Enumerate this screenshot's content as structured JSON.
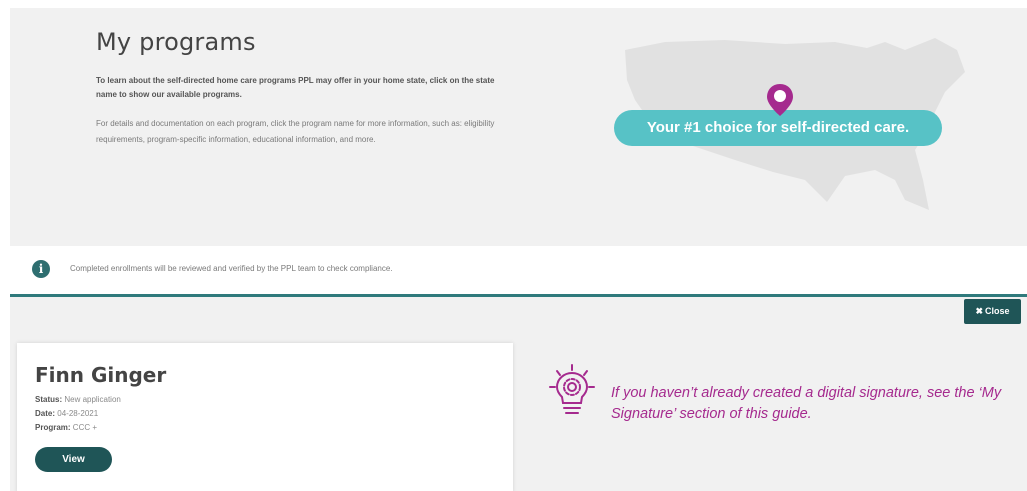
{
  "header": {
    "title": "My programs",
    "intro": "To learn about the self-directed home care programs PPL may offer in your home state, click on the state name to show our available programs.",
    "details": "For details and documentation on each program, click the program name for more information, such as: eligibility requirements, program-specific information, educational information, and more.",
    "tagline": "Your #1 choice for self-directed care."
  },
  "notice": {
    "icon": "info-icon",
    "text": "Completed enrollments will be reviewed and verified by the PPL team to check compliance."
  },
  "close_button": {
    "icon": "close-icon",
    "label": "Close"
  },
  "enrollment_card": {
    "name": "Finn Ginger",
    "status_label": "Status:",
    "status_value": "New application",
    "date_label": "Date:",
    "date_value": "04-28-2021",
    "program_label": "Program:",
    "program_value": "CCC +",
    "view_label": "View"
  },
  "tip": {
    "icon": "lightbulb-gear-icon",
    "text": "If you haven’t already created a digital signature, see the ‘My Signature’ section of this guide."
  },
  "colors": {
    "accent_teal": "#57c2c6",
    "dark_teal": "#1f5557",
    "magenta": "#a52a8e"
  }
}
